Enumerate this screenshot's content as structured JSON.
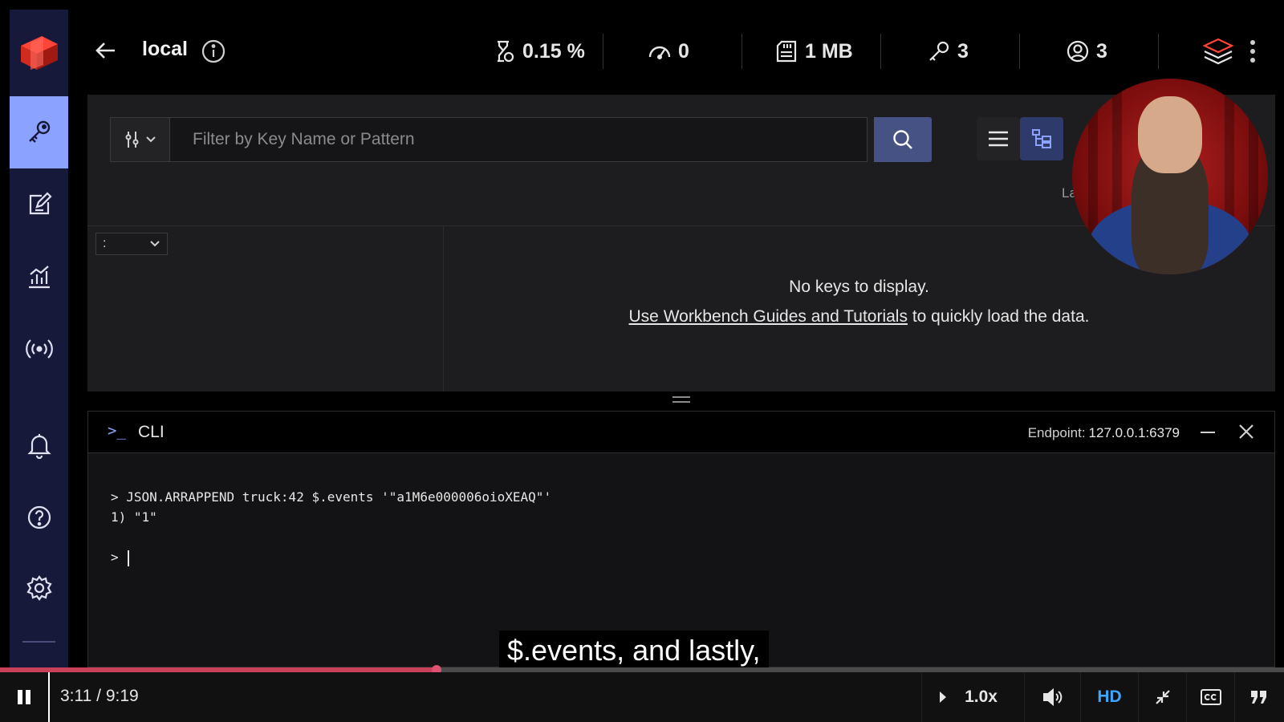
{
  "topbar": {
    "db_name": "local",
    "stats": {
      "cpu": "0.15 %",
      "ops": "0",
      "memory": "1 MB",
      "keys": "3",
      "clients": "3"
    }
  },
  "sidebar": {
    "items": [
      {
        "name": "browser",
        "icon": "key-icon",
        "active": true
      },
      {
        "name": "workbench",
        "icon": "edit-icon",
        "active": false
      },
      {
        "name": "analytics",
        "icon": "analytics-icon",
        "active": false
      },
      {
        "name": "pubsub",
        "icon": "broadcast-icon",
        "active": false
      },
      {
        "name": "notifications",
        "icon": "bell-icon",
        "active": false
      },
      {
        "name": "help",
        "icon": "help-icon",
        "active": false
      },
      {
        "name": "settings",
        "icon": "gear-icon",
        "active": false
      }
    ]
  },
  "browser": {
    "search": {
      "placeholder": "Filter by Key Name or Pattern",
      "value": ""
    },
    "hidden_label": "La",
    "delimiter": ":",
    "empty_title": "No keys to display.",
    "empty_link": "Use Workbench Guides and Tutorials",
    "empty_suffix": " to quickly load the data."
  },
  "cli": {
    "prompt_icon": ">_",
    "title": "CLI",
    "endpoint_label": "Endpoint:",
    "endpoint_value": "127.0.0.1:6379",
    "history": [
      "> JSON.ARRAPPEND truck:42 $.events '\"a1M6e000006oioXEAQ\"'",
      "1) \"1\""
    ],
    "input_prompt": "> ",
    "input_value": ""
  },
  "video": {
    "subtitle": "$.events, and lastly,",
    "time": "3:11 / 9:19",
    "progress": 0.34,
    "speed": "1.0x",
    "quality": "HD",
    "accent_color": "#c8415b"
  }
}
